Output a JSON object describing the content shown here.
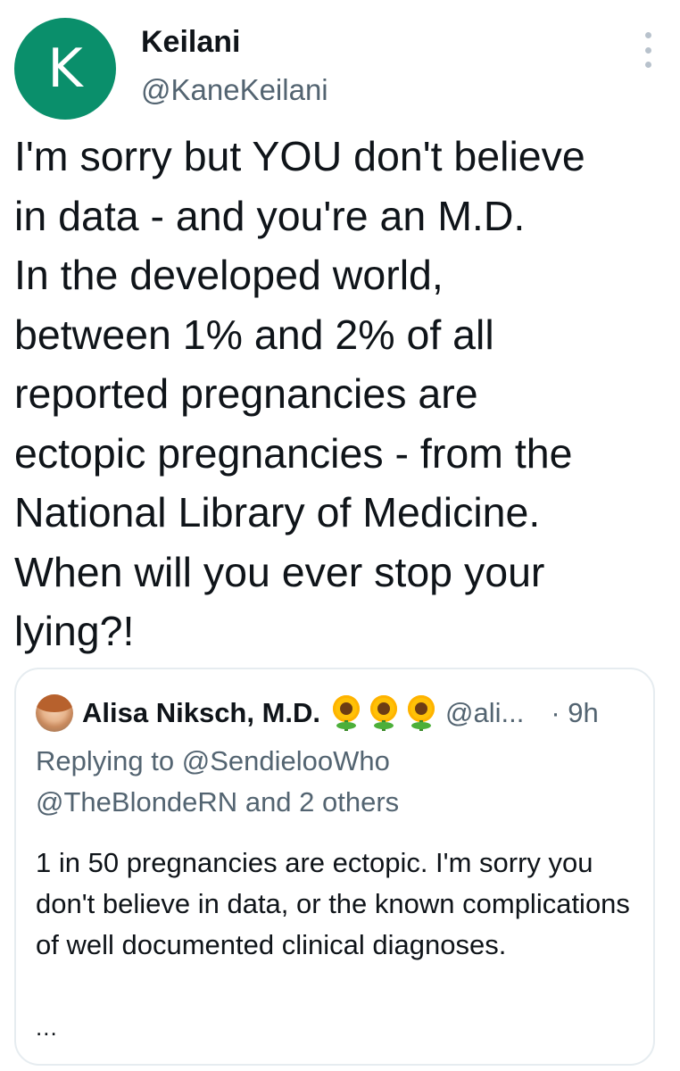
{
  "tweet": {
    "avatar_letter": "K",
    "display_name": "Keilani",
    "handle": "@KaneKeilani",
    "more_icon": "more-vertical-icon",
    "text": "I'm sorry but YOU don't believe\nin data - and you're an M.D.\nIn the developed world,\nbetween 1% and 2% of all\nreported pregnancies are\nectopic pregnancies - from the\nNational Library of Medicine.\nWhen will you ever stop your\nlying?!"
  },
  "quote": {
    "name": "Alisa Niksch, M.D.",
    "emoji": [
      "sunflower-icon",
      "sunflower-icon",
      "sunflower-icon"
    ],
    "handle": "@ali...",
    "time": "· 9h",
    "replying_prefix": "Replying to",
    "replying_mention_1": "@SendielooWho",
    "replying_mention_2": "@TheBlondeRN",
    "replying_suffix": "and 2 others",
    "text": "1 in 50 pregnancies are ectopic. I'm sorry you don't believe in data, or the known complications of well documented clinical diagnoses.",
    "ellipsis": "..."
  },
  "colors": {
    "avatar_bg": "#0a8f6b",
    "secondary_text": "#536471",
    "primary_text": "#0f1419",
    "border": "#e6ecf0"
  }
}
